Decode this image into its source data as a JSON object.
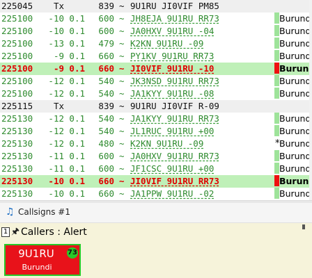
{
  "log_rows": [
    {
      "kind": "tx",
      "time": "225045",
      "db": "Tx",
      "dt": "",
      "freq": "839",
      "tilde": "~",
      "msg": "9U1RU JI0VIF PM85",
      "mark": "",
      "star": "",
      "country": ""
    },
    {
      "kind": "rx",
      "time": "225100",
      "db": "-10",
      "dt": "0.1",
      "freq": "600",
      "tilde": "~",
      "msg": "JH8EJA 9U1RU RR73",
      "mark": "g",
      "star": "",
      "country": "Burundi"
    },
    {
      "kind": "rx",
      "time": "225100",
      "db": "-10",
      "dt": "0.1",
      "freq": "600",
      "tilde": "~",
      "msg": "JA0HXV 9U1RU -04",
      "mark": "g",
      "star": "",
      "country": "Burundi"
    },
    {
      "kind": "rx",
      "time": "225100",
      "db": "-13",
      "dt": "0.1",
      "freq": "479",
      "tilde": "~",
      "msg": "K2KN 9U1RU -09",
      "mark": "g",
      "star": "",
      "country": "Burundi"
    },
    {
      "kind": "rx",
      "time": "225100",
      "db": "-9",
      "dt": "0.1",
      "freq": "660",
      "tilde": "~",
      "msg": "PY1KV 9U1RU RR73",
      "mark": "g",
      "star": "",
      "country": "Burundi"
    },
    {
      "kind": "alert",
      "time": "225100",
      "db": "-9",
      "dt": "0.1",
      "freq": "660",
      "tilde": "~",
      "msg": "JI0VIF 9U1RU -10",
      "mark": "r",
      "star": "",
      "country": "Burundi"
    },
    {
      "kind": "rx",
      "time": "225100",
      "db": "-12",
      "dt": "0.1",
      "freq": "540",
      "tilde": "~",
      "msg": "JK3NSD 9U1RU RR73",
      "mark": "g",
      "star": "",
      "country": "Burundi"
    },
    {
      "kind": "rx",
      "time": "225100",
      "db": "-12",
      "dt": "0.1",
      "freq": "540",
      "tilde": "~",
      "msg": "JA1KYY 9U1RU -08",
      "mark": "g",
      "star": "",
      "country": "Burundi"
    },
    {
      "kind": "tx",
      "time": "225115",
      "db": "Tx",
      "dt": "",
      "freq": "839",
      "tilde": "~",
      "msg": "9U1RU JI0VIF R-09",
      "mark": "",
      "star": "",
      "country": ""
    },
    {
      "kind": "rx",
      "time": "225130",
      "db": "-12",
      "dt": "0.1",
      "freq": "540",
      "tilde": "~",
      "msg": "JA1KYY 9U1RU RR73",
      "mark": "g",
      "star": "",
      "country": "Burundi"
    },
    {
      "kind": "rx",
      "time": "225130",
      "db": "-12",
      "dt": "0.1",
      "freq": "540",
      "tilde": "~",
      "msg": "JL1RUC 9U1RU +00",
      "mark": "g",
      "star": "",
      "country": "Burundi"
    },
    {
      "kind": "rx",
      "time": "225130",
      "db": "-12",
      "dt": "0.1",
      "freq": "480",
      "tilde": "~",
      "msg": "K2KN 9U1RU -09",
      "mark": "",
      "star": "*",
      "country": "Burundi"
    },
    {
      "kind": "rx",
      "time": "225130",
      "db": "-11",
      "dt": "0.1",
      "freq": "600",
      "tilde": "~",
      "msg": "JA0HXV 9U1RU RR73",
      "mark": "g",
      "star": "",
      "country": "Burundi"
    },
    {
      "kind": "rx",
      "time": "225130",
      "db": "-11",
      "dt": "0.1",
      "freq": "600",
      "tilde": "~",
      "msg": "JF1CSC 9U1RU +00",
      "mark": "g",
      "star": "",
      "country": "Burundi"
    },
    {
      "kind": "alert",
      "time": "225130",
      "db": "-10",
      "dt": "0.1",
      "freq": "660",
      "tilde": "~",
      "msg": "JI0VIF 9U1RU RR73",
      "mark": "r",
      "star": "",
      "country": "Burundi"
    },
    {
      "kind": "rx",
      "time": "225130",
      "db": "-10",
      "dt": "0.1",
      "freq": "660",
      "tilde": "~",
      "msg": "JA1PPW 9U1RU -02",
      "mark": "g",
      "star": "",
      "country": "Burundi"
    }
  ],
  "panel": {
    "icon": "music-note-icon",
    "title": "Callsigns #1"
  },
  "callers": {
    "index_label": "1",
    "pin_icon": "pin-icon",
    "title": "Callers : Alert",
    "cards": [
      {
        "call": "9U1RU",
        "country": "Burundi",
        "score": "73"
      }
    ]
  },
  "colors": {
    "rx_text": "#2e8b2e",
    "alert_text": "#e00000",
    "alert_row_bg": "#bff0b8",
    "mark_green": "#9ee39a",
    "mark_red": "#ee1111",
    "card_bg": "#e8121a",
    "card_border": "#28c828",
    "callers_bg": "#f6f3da"
  }
}
